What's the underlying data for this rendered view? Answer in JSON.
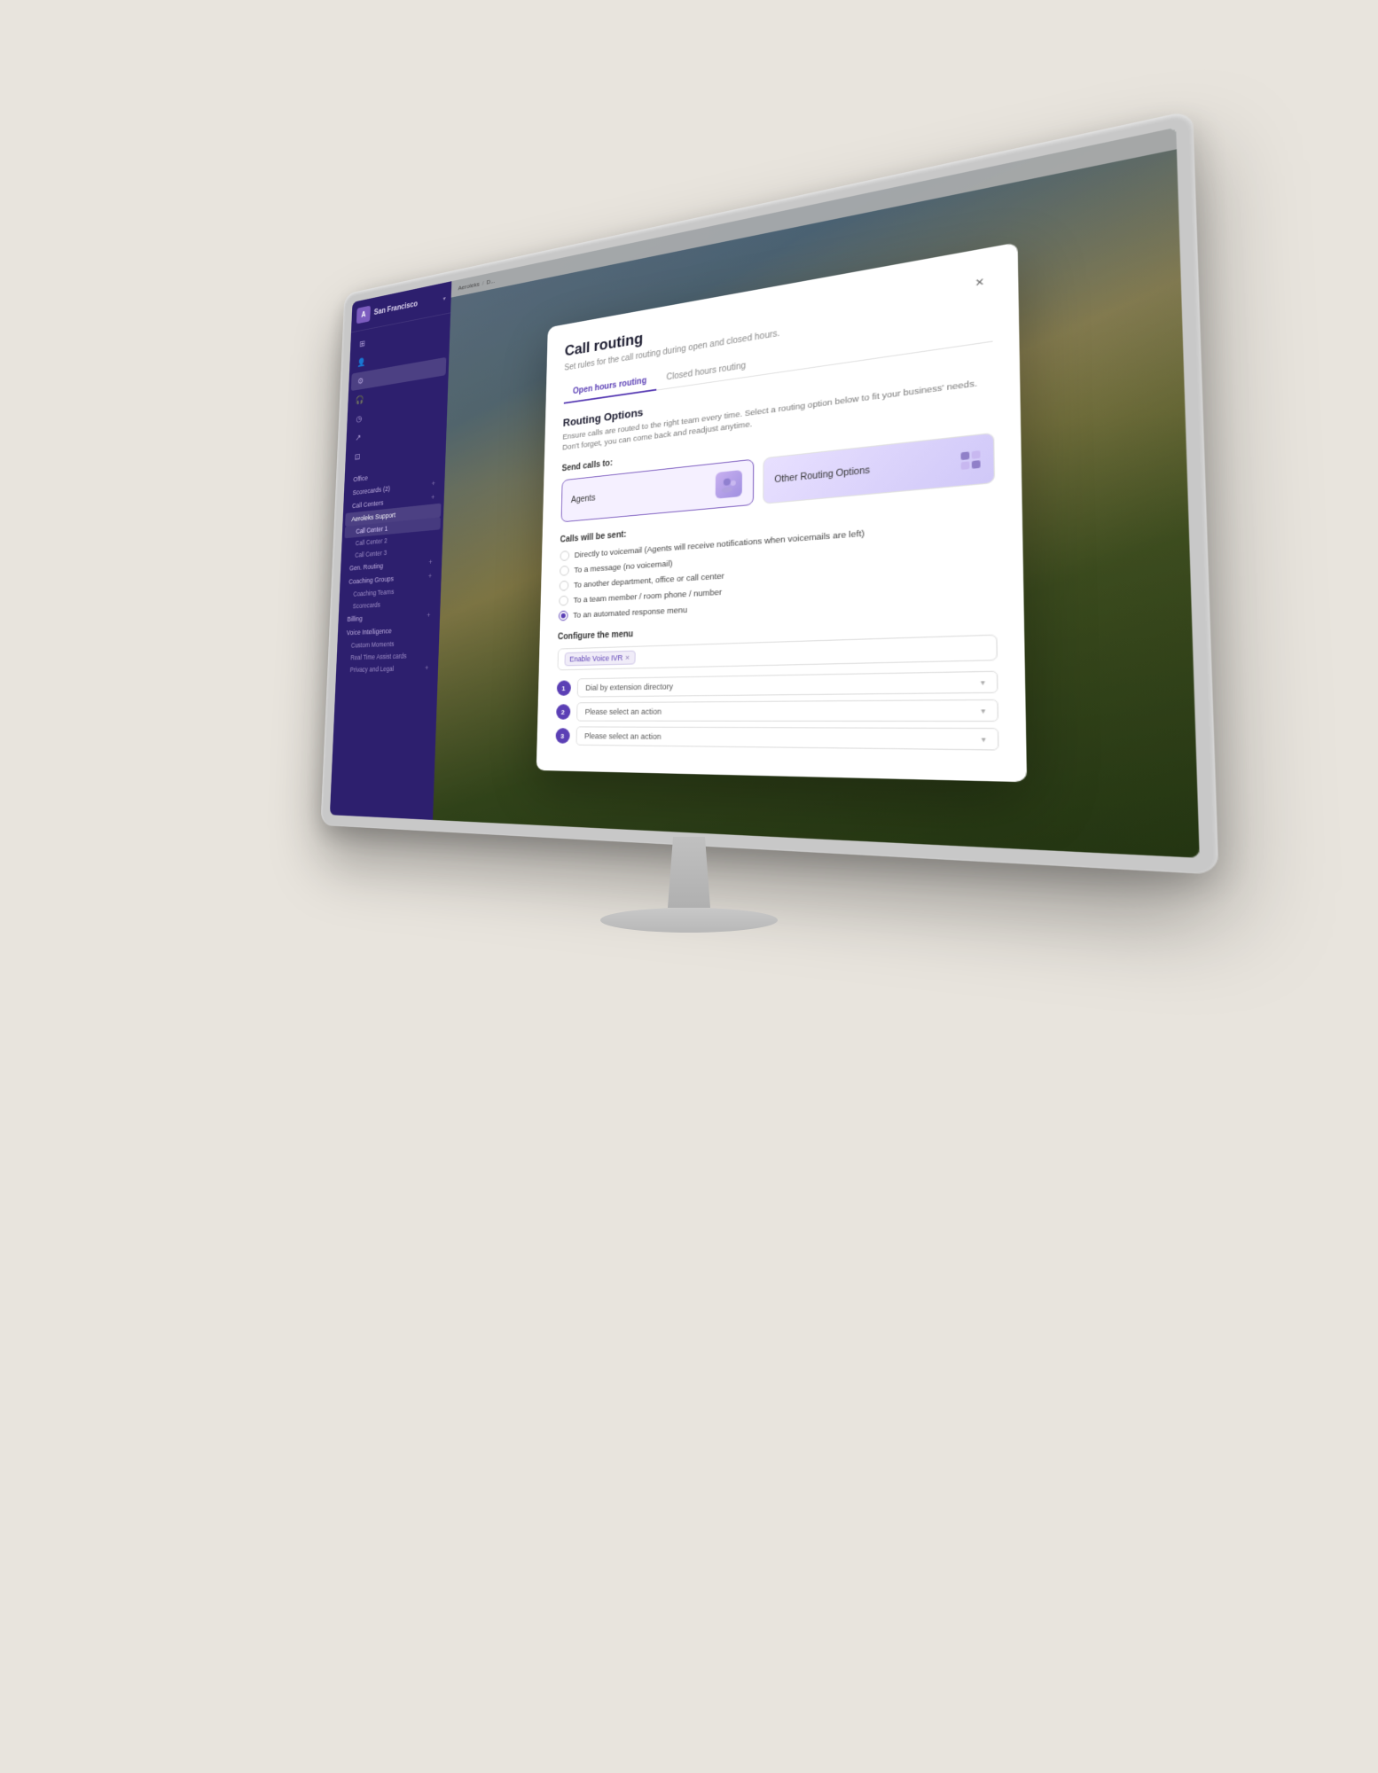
{
  "sidebar": {
    "org_name": "San Francisco",
    "logo_text": "A",
    "nav_items": [
      {
        "label": "Office",
        "level": 1
      },
      {
        "label": "Scorecards (2)",
        "level": 1,
        "has_plus": true
      },
      {
        "label": "Call Centers",
        "level": 1,
        "has_plus": true
      },
      {
        "label": "Aeroleks Support",
        "level": 1,
        "highlighted": true
      },
      {
        "label": "Call Center 1",
        "level": 2
      },
      {
        "label": "Call Center 2",
        "level": 2
      },
      {
        "label": "Call Center 3",
        "level": 2
      },
      {
        "label": "Gen. Routing",
        "level": 1,
        "has_plus": true
      },
      {
        "label": "Coaching Groups",
        "level": 1,
        "has_plus": true
      },
      {
        "label": "Coaching Teams",
        "level": 2
      },
      {
        "label": "Scorecards",
        "level": 2
      },
      {
        "label": "Billing",
        "level": 1,
        "has_plus": true
      },
      {
        "label": "Voice Intelligence",
        "level": 1
      },
      {
        "label": "Custom Moments",
        "level": 2
      },
      {
        "label": "Real Time Assist cards",
        "level": 2
      },
      {
        "label": "Privacy and Legal",
        "level": 2,
        "has_plus": true
      }
    ]
  },
  "breadcrumb": {
    "items": [
      "Aeroleks",
      "D..."
    ]
  },
  "dialog": {
    "title": "Call routing",
    "subtitle": "Set rules for the call routing during open and closed hours.",
    "close_label": "×",
    "tabs": [
      {
        "label": "Open hours routing",
        "active": true
      },
      {
        "label": "Closed hours routing",
        "active": false
      }
    ],
    "routing_options": {
      "section_title": "Routing Options",
      "section_desc": "Ensure calls are routed to the right team every time. Select a routing option below to fit your business' needs. Don't forget, you can come back and readjust anytime.",
      "send_label": "Send calls to:",
      "cards": [
        {
          "label": "Agents",
          "active": true
        },
        {
          "label": "Other Routing Options",
          "active": false
        }
      ]
    },
    "calls_will_be_sent": {
      "label": "Calls will be sent:",
      "options": [
        {
          "label": "Directly to voicemail (Agents will receive notifications when voicemails are left)",
          "selected": false
        },
        {
          "label": "To a message (no voicemail)",
          "selected": false
        },
        {
          "label": "To another department, office or call center",
          "selected": false
        },
        {
          "label": "To a team member / room phone / number",
          "selected": false
        },
        {
          "label": "To an automated response menu",
          "selected": true
        }
      ]
    },
    "configure_menu": {
      "label": "Configure the menu",
      "tag": "Enable Voice IVR",
      "menu_items": [
        {
          "num": 1,
          "value": "Dial by extension directory"
        },
        {
          "num": 2,
          "value": "Please select an action"
        },
        {
          "num": 3,
          "value": "Please select an action"
        }
      ]
    }
  }
}
